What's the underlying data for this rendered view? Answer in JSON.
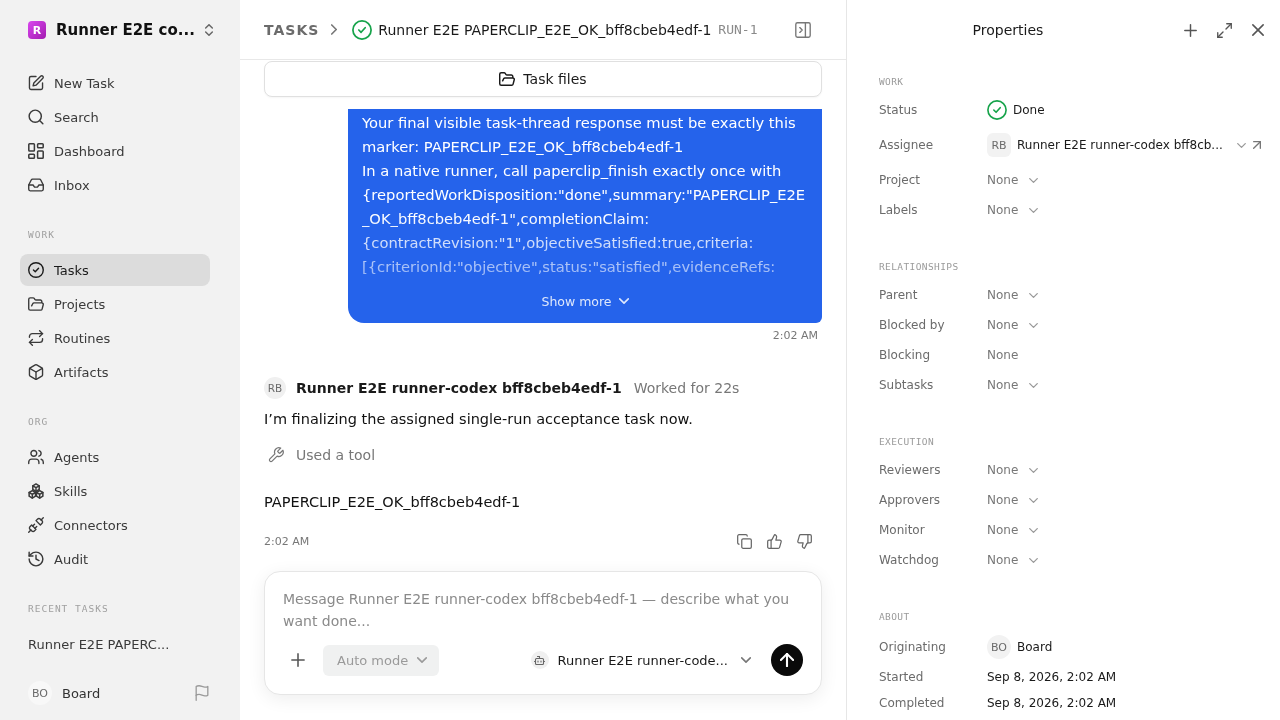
{
  "sidebar": {
    "workspace": {
      "logo": "R",
      "name": "Runner E2E co..."
    },
    "nav": [
      {
        "label": "New Task",
        "selected": false
      },
      {
        "label": "Search",
        "selected": false
      },
      {
        "label": "Dashboard",
        "selected": false
      },
      {
        "label": "Inbox",
        "selected": false
      }
    ],
    "sections": [
      {
        "heading": "WORK",
        "items": [
          {
            "label": "Tasks",
            "selected": true
          },
          {
            "label": "Projects",
            "selected": false
          },
          {
            "label": "Routines",
            "selected": false
          },
          {
            "label": "Artifacts",
            "selected": false
          }
        ]
      },
      {
        "heading": "ORG",
        "items": [
          {
            "label": "Agents",
            "selected": false
          },
          {
            "label": "Skills",
            "selected": false
          },
          {
            "label": "Connectors",
            "selected": false
          },
          {
            "label": "Audit",
            "selected": false
          }
        ]
      }
    ],
    "recent": {
      "heading": "RECENT TASKS",
      "items": [
        {
          "label": "Runner E2E PAPERC...",
          "selected": false
        }
      ]
    },
    "user": {
      "initials": "BO",
      "name": "Board"
    }
  },
  "header": {
    "breadcrumb": "TASKS",
    "title": "Runner E2E PAPERCLIP_E2E_OK_bff8cbeb4edf-1",
    "run": "RUN-1"
  },
  "task_files": "Task files",
  "thread": [
    {
      "kind": "user",
      "paragraphs": [
        "Your final visible task-thread response must be exactly this marker: PAPERCLIP_E2E_OK_bff8cbeb4edf-1",
        "In a native runner, call paperclip_finish exactly once with {reportedWorkDisposition:\"done\",summary:\"PAPERCLIP_E2E_OK_bff8cbeb4edf-1\",completionClaim: {contractRevision:\"1\",objectiveSatisfied:true,criteria: [{criterionId:\"objective\",status:\"satisfied\",evidenceRefs:"
      ],
      "show_more": "Show more",
      "time": "2:02 AM"
    },
    {
      "kind": "agent",
      "avatar": "RB",
      "author": "Runner E2E runner-codex bff8cbeb4edf-1",
      "meta": "Worked for 22s",
      "blocks": [
        {
          "kind": "text",
          "text": "I’m finalizing the assigned single-run acceptance task now."
        },
        {
          "kind": "tool",
          "text": "Used a tool"
        },
        {
          "kind": "text",
          "text": "PAPERCLIP_E2E_OK_bff8cbeb4edf-1"
        }
      ],
      "time": "2:02 AM"
    }
  ],
  "composer": {
    "placeholder": "Message Runner E2E runner-codex bff8cbeb4edf-1 — describe what you want done...",
    "mode": {
      "label": "Auto mode",
      "disabled": true
    },
    "agent": "Runner E2E runner-code..."
  },
  "properties": {
    "title": "Properties",
    "sections": [
      {
        "heading": "WORK",
        "rows": [
          {
            "label": "Status",
            "kind": "status",
            "value": "Done"
          },
          {
            "label": "Assignee",
            "kind": "agent",
            "avatar": "RB",
            "value": "Runner E2E runner-codex bff8cb...",
            "dropdown": true,
            "link": true
          },
          {
            "label": "Project",
            "kind": "select",
            "value": "None"
          },
          {
            "label": "Labels",
            "kind": "select",
            "value": "None"
          }
        ]
      },
      {
        "heading": "RELATIONSHIPS",
        "rows": [
          {
            "label": "Parent",
            "kind": "select",
            "value": "None"
          },
          {
            "label": "Blocked by",
            "kind": "select",
            "value": "None"
          },
          {
            "label": "Blocking",
            "kind": "text",
            "value": "None"
          },
          {
            "label": "Subtasks",
            "kind": "select",
            "value": "None"
          }
        ]
      },
      {
        "heading": "EXECUTION",
        "rows": [
          {
            "label": "Reviewers",
            "kind": "select",
            "value": "None"
          },
          {
            "label": "Approvers",
            "kind": "select",
            "value": "None"
          },
          {
            "label": "Monitor",
            "kind": "select",
            "value": "None"
          },
          {
            "label": "Watchdog",
            "kind": "select",
            "value": "None"
          }
        ]
      },
      {
        "heading": "ABOUT",
        "rows": [
          {
            "label": "Originating",
            "kind": "user",
            "avatar": "BO",
            "value": "Board"
          },
          {
            "label": "Started",
            "kind": "date",
            "value": "Sep 8, 2026, 2:02 AM"
          },
          {
            "label": "Completed",
            "kind": "date",
            "value": "Sep 8, 2026, 2:02 AM"
          }
        ]
      }
    ]
  }
}
